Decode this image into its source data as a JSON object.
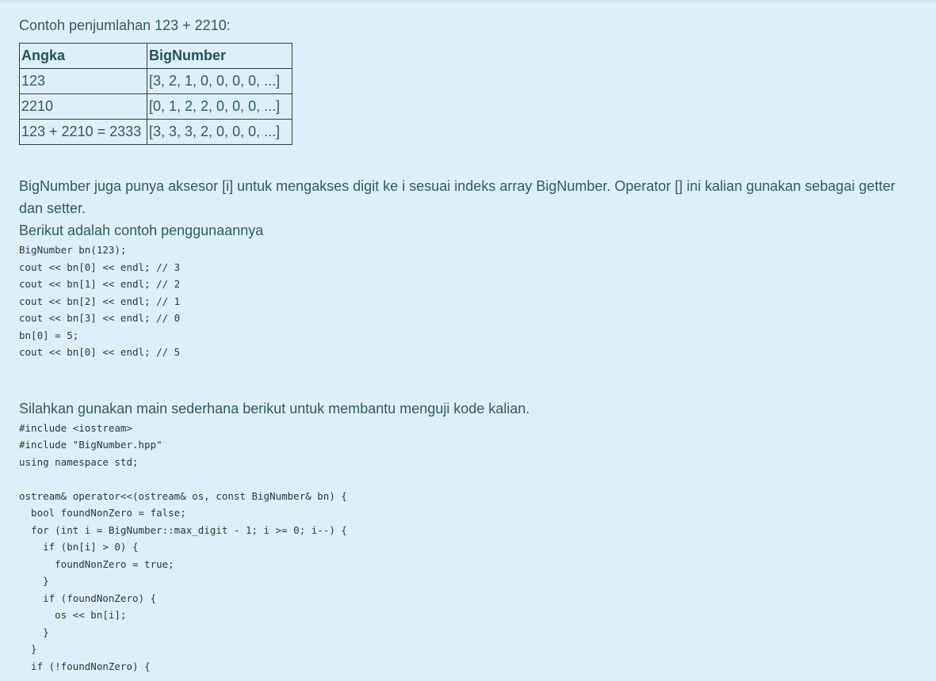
{
  "intro": "Contoh penjumlahan 123 + 2210:",
  "table": {
    "headers": [
      "Angka",
      "BigNumber"
    ],
    "rows": [
      [
        "123",
        "[3, 2, 1, 0, 0, 0, 0, ...]"
      ],
      [
        "2210",
        "[0, 1, 2, 2, 0, 0, 0, ...]"
      ],
      [
        "123 + 2210 = 2333",
        "[3, 3, 3, 2, 0, 0, 0, ...]"
      ]
    ]
  },
  "paragraph_accessor": "BigNumber juga punya aksesor [i] untuk mengakses digit ke i sesuai indeks array BigNumber. Operator [] ini kalian gunakan sebagai getter dan setter.",
  "paragraph_example": "Berikut adalah contoh penggunaannya",
  "code_example": "BigNumber bn(123);\ncout << bn[0] << endl; // 3\ncout << bn[1] << endl; // 2\ncout << bn[2] << endl; // 1\ncout << bn[3] << endl; // 0\nbn[0] = 5;\ncout << bn[0] << endl; // 5",
  "paragraph_main": "Silahkan gunakan main sederhana berikut untuk membantu menguji kode kalian.",
  "code_main": "#include <iostream>\n#include \"BigNumber.hpp\"\nusing namespace std;\n\nostream& operator<<(ostream& os, const BigNumber& bn) {\n  bool foundNonZero = false;\n  for (int i = BigNumber::max_digit - 1; i >= 0; i--) {\n    if (bn[i] > 0) {\n      foundNonZero = true;\n    }\n    if (foundNonZero) {\n      os << bn[i];\n    }\n  }\n  if (!foundNonZero) {"
}
